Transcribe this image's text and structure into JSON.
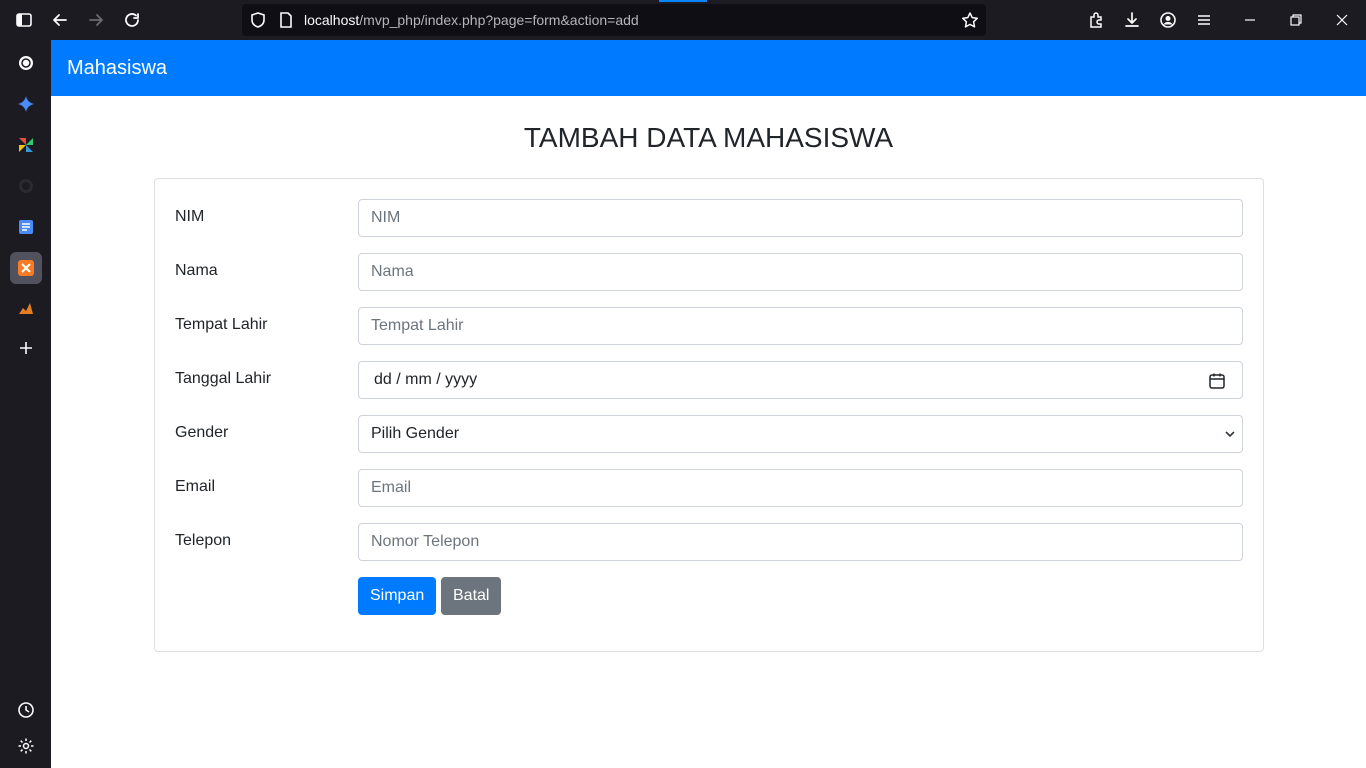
{
  "browser": {
    "url_host": "localhost",
    "url_path": "/mvp_php/index.php?page=form&action=add"
  },
  "navbar": {
    "brand": "Mahasiswa"
  },
  "page": {
    "title": "TAMBAH DATA MAHASISWA"
  },
  "form": {
    "nim": {
      "label": "NIM",
      "placeholder": "NIM"
    },
    "nama": {
      "label": "Nama",
      "placeholder": "Nama"
    },
    "tempat_lahir": {
      "label": "Tempat Lahir",
      "placeholder": "Tempat Lahir"
    },
    "tanggal_lahir": {
      "label": "Tanggal Lahir",
      "value": "dd / mm / yyyy"
    },
    "gender": {
      "label": "Gender",
      "selected": "Pilih Gender"
    },
    "email": {
      "label": "Email",
      "placeholder": "Email"
    },
    "telepon": {
      "label": "Telepon",
      "placeholder": "Nomor Telepon"
    },
    "save_label": "Simpan",
    "cancel_label": "Batal"
  },
  "colors": {
    "navbar_bg": "#007bff",
    "primary": "#007bff",
    "secondary": "#6c757d",
    "chrome_bg": "#1c1b22"
  }
}
